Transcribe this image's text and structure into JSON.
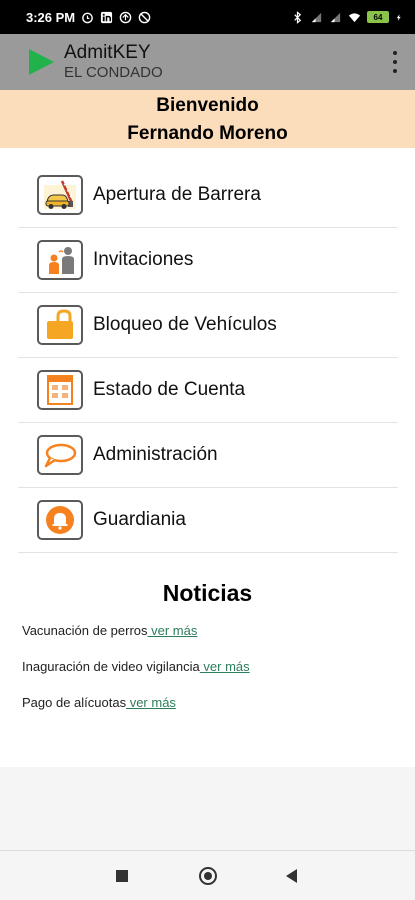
{
  "status_bar": {
    "time": "3:26 PM",
    "battery_level": "64",
    "left_icons": [
      "alarm-icon",
      "linkedin-icon",
      "data-saver-icon",
      "dnd-icon"
    ],
    "right_icons": [
      "bluetooth-icon",
      "signal-icon",
      "signal-icon",
      "wifi-icon",
      "battery-icon",
      "charging-icon"
    ]
  },
  "app_bar": {
    "title": "AdmitKEY",
    "subtitle": "EL CONDADO",
    "logo_icon": "green-triangle-logo",
    "menu_icon": "overflow-menu-icon"
  },
  "welcome": {
    "greeting": "Bienvenido",
    "user_name": "Fernando Moreno"
  },
  "menu": {
    "items": [
      {
        "label": "Apertura de Barrera",
        "icon": "barrier-car-icon"
      },
      {
        "label": "Invitaciones",
        "icon": "invitation-people-icon"
      },
      {
        "label": "Bloqueo de Vehículos",
        "icon": "lock-icon"
      },
      {
        "label": "Estado de Cuenta",
        "icon": "account-statement-icon"
      },
      {
        "label": "Administración",
        "icon": "chat-bubble-icon"
      },
      {
        "label": "Guardiania",
        "icon": "bell-icon"
      }
    ]
  },
  "news": {
    "title": "Noticias",
    "items": [
      {
        "text": "Vacunación de perros",
        "link": " ver más"
      },
      {
        "text": "Inaguración de video vigilancia",
        "link": " ver más"
      },
      {
        "text": "Pago de alícuotas",
        "link": " ver más"
      }
    ]
  },
  "colors": {
    "app_bar": "#9a9a9a",
    "welcome_bg": "#fbdcbb",
    "accent_orange": "#f5821f",
    "logo_green": "#21b24b",
    "link_green": "#2e7d5b"
  }
}
